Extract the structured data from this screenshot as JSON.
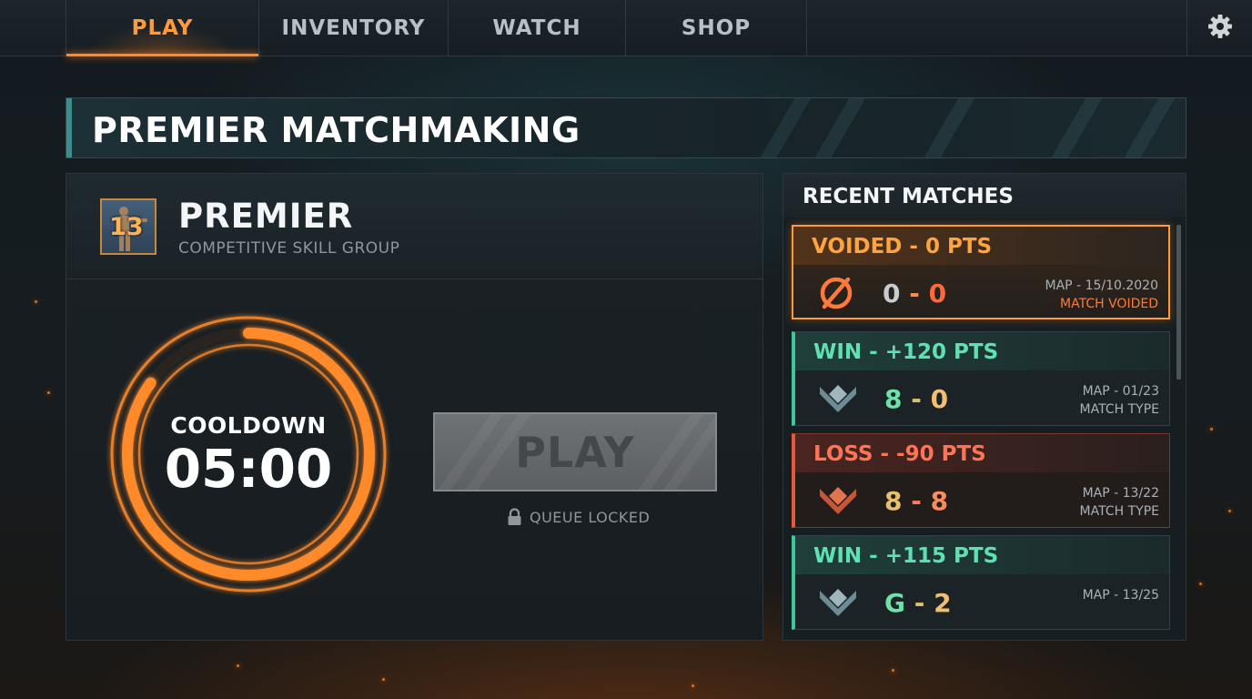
{
  "nav": {
    "tabs": [
      {
        "label": "PLAY",
        "active": true
      },
      {
        "label": "INVENTORY",
        "active": false
      },
      {
        "label": "WATCH",
        "active": false
      },
      {
        "label": "SHOP",
        "active": false
      }
    ],
    "settings_icon": "gear-icon"
  },
  "banner": {
    "title": "PREMIER MATCHMAKING"
  },
  "rank": {
    "badge_number": "13",
    "title": "PREMIER",
    "subtitle": "COMPETITIVE SKILL GROUP"
  },
  "cooldown": {
    "label": "COOLDOWN",
    "time": "05:00",
    "progress": 0.85,
    "color": "#ff8a2a"
  },
  "play_button": {
    "label": "PLAY",
    "state": "disabled"
  },
  "queue": {
    "status": "QUEUE LOCKED",
    "icon": "lock-icon"
  },
  "recent_matches": {
    "title": "RECENT MATCHES",
    "items": [
      {
        "result": "VOIDED - 0 PTS",
        "icon": "void-icon",
        "score_left": "0",
        "score_sep": "-",
        "score_right": "0",
        "map": "MAP - 15/10.2020",
        "type": "MATCH VOIDED",
        "status": "voided"
      },
      {
        "result": "WIN  - +120 PTS",
        "icon": "rank-chevron-icon",
        "score_left": "8",
        "score_sep": "-",
        "score_right": "0",
        "map": "MAP - 01/23",
        "type": "MATCH TYPE",
        "status": "win"
      },
      {
        "result": "LOSS - -90 PTS",
        "icon": "rank-chevron-icon",
        "score_left": "8",
        "score_sep": "-",
        "score_right": "8",
        "map": "MAP - 13/22",
        "type": "MATCH TYPE",
        "status": "loss"
      },
      {
        "result": "WIN - +115 PTS",
        "icon": "rank-chevron-icon",
        "score_left": "G",
        "score_sep": "-",
        "score_right": "2",
        "map": "MAP - 13/25",
        "type": "",
        "status": "win"
      }
    ]
  },
  "colors": {
    "accent": "#ff8a2a",
    "win": "#5fe0b0",
    "loss": "#ff7455",
    "voided": "#ffa33f"
  }
}
